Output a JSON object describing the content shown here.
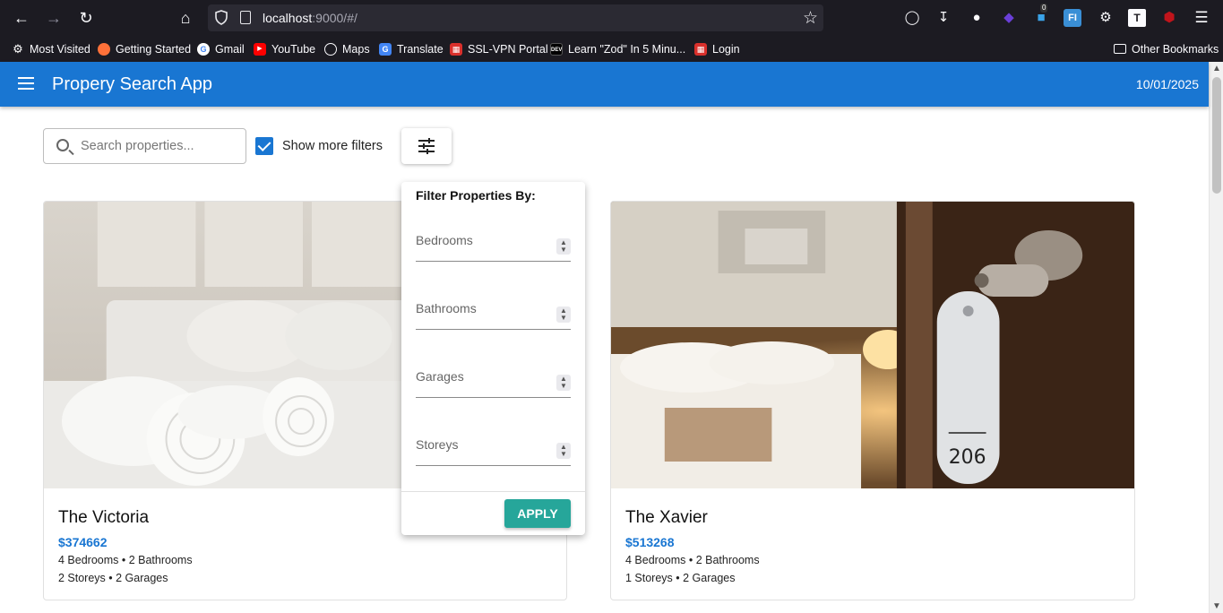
{
  "browser": {
    "url_host": "localhost",
    "url_rest": ":9000/#/",
    "bookmarks": [
      {
        "label": "Most Visited",
        "icon": "gear-icon"
      },
      {
        "label": "Getting Started",
        "icon": "firefox-icon"
      },
      {
        "label": "Gmail",
        "icon": "google-icon"
      },
      {
        "label": "YouTube",
        "icon": "youtube-icon"
      },
      {
        "label": "Maps",
        "icon": "globe-icon"
      },
      {
        "label": "Translate",
        "icon": "translate-icon"
      },
      {
        "label": "SSL-VPN Portal",
        "icon": "vpn-icon"
      },
      {
        "label": "Learn \"Zod\" In 5 Minu...",
        "icon": "dev-icon"
      },
      {
        "label": "Login",
        "icon": "login-icon"
      }
    ],
    "other_bookmarks": "Other Bookmarks",
    "badge_count": "0"
  },
  "app": {
    "title": "Propery Search App",
    "date": "10/01/2025"
  },
  "search": {
    "placeholder": "Search properties...",
    "show_more_label": "Show more filters",
    "show_more_checked": true
  },
  "filters": {
    "title": "Filter Properties By:",
    "fields": [
      "Bedrooms",
      "Bathrooms",
      "Garages",
      "Storeys"
    ],
    "apply_label": "APPLY"
  },
  "properties": [
    {
      "name": "The Victoria",
      "price": "$374662",
      "line1": "4 Bedrooms • 2 Bathrooms",
      "line2": "2 Storeys • 2 Garages"
    },
    {
      "name": "The Xavier",
      "price": "$513268",
      "line1": "4 Bedrooms • 2 Bathrooms",
      "line2": "1 Storeys • 2 Garages",
      "key_tag": "206"
    }
  ],
  "colors": {
    "appbar": "#1976d2",
    "apply": "#26a69a",
    "price": "#1976d2"
  }
}
